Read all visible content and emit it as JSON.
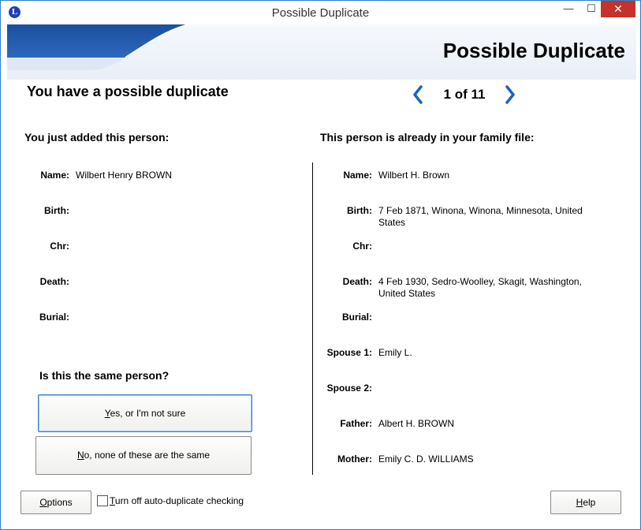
{
  "window": {
    "title": "Possible Duplicate",
    "app_icon_letter": "L",
    "controls": {
      "minimize": "—",
      "maximize": "☐",
      "close": "✕"
    }
  },
  "banner": {
    "title": "Possible Duplicate"
  },
  "header": {
    "subtitle": "You have a possible duplicate",
    "counter": "1 of 11"
  },
  "left": {
    "heading": "You just added this person:",
    "fields": [
      {
        "label": "Name:",
        "value": "Wilbert Henry BROWN"
      },
      {
        "label": "Birth:",
        "value": ""
      },
      {
        "label": "Chr:",
        "value": ""
      },
      {
        "label": "Death:",
        "value": ""
      },
      {
        "label": "Burial:",
        "value": ""
      }
    ]
  },
  "right": {
    "heading": "This person is already in your family file:",
    "fields": [
      {
        "label": "Name:",
        "value": "Wilbert H. Brown"
      },
      {
        "label": "Birth:",
        "value": "7 Feb 1871, Winona, Winona, Minnesota, United States"
      },
      {
        "label": "Chr:",
        "value": ""
      },
      {
        "label": "Death:",
        "value": "4 Feb 1930, Sedro-Woolley, Skagit, Washington, United States"
      },
      {
        "label": "Burial:",
        "value": ""
      },
      {
        "label": "Spouse 1:",
        "value": "Emily L."
      },
      {
        "label": "Spouse 2:",
        "value": ""
      },
      {
        "label": "Father:",
        "value": "Albert H. BROWN"
      },
      {
        "label": "Mother:",
        "value": "Emily C. D. WILLIAMS"
      }
    ]
  },
  "question": "Is this the same person?",
  "buttons": {
    "yes_key": "Y",
    "yes_rest": "es, or I'm not sure",
    "no_key": "N",
    "no_rest": "o, none of these are the same",
    "options_key": "O",
    "options_rest": "ptions",
    "help_key": "H",
    "help_rest": "elp"
  },
  "auto_check": {
    "label_key": "T",
    "label_rest": "urn off auto-duplicate checking",
    "checked": false
  },
  "colors": {
    "accent": "#1e63b5",
    "close": "#c7312b",
    "border": "#2b7fc9"
  }
}
